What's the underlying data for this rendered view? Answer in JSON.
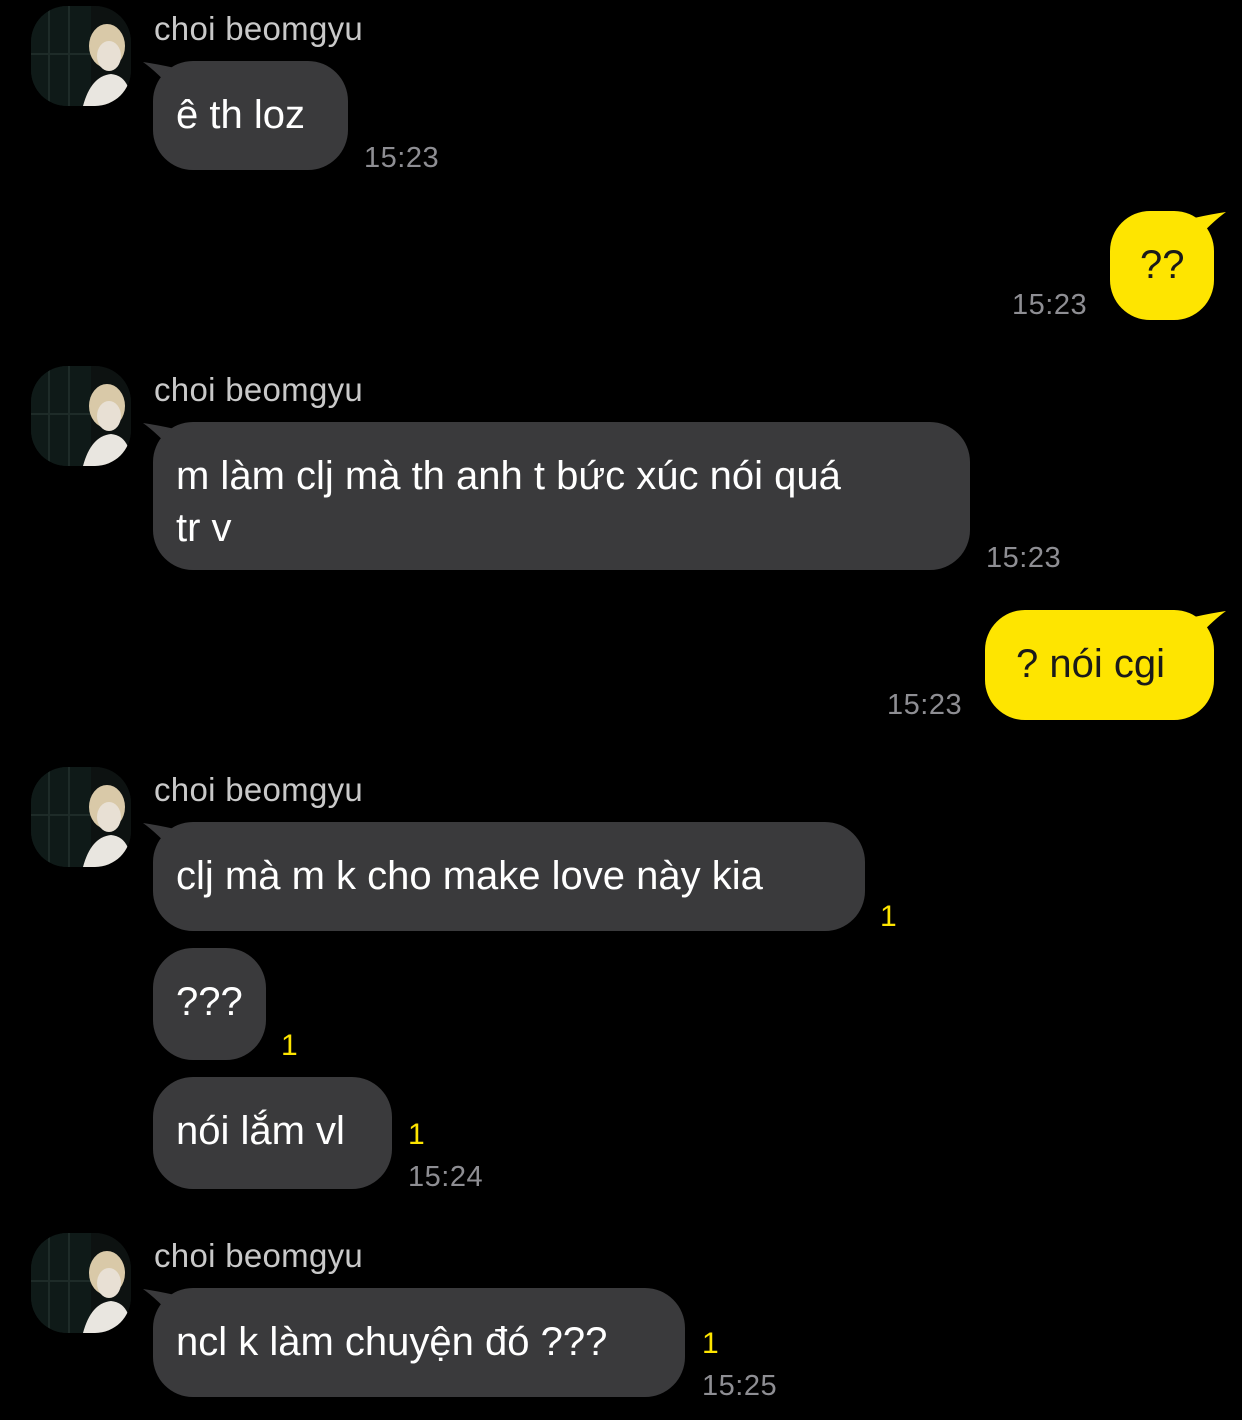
{
  "contact": {
    "name": "choi beomgyu"
  },
  "colors": {
    "background": "#000000",
    "incoming_bubble": "#3a3a3c",
    "outgoing_bubble": "#fee500",
    "timestamp": "#8e8e93",
    "unread_count": "#fee500",
    "sender_name": "#c9c9c9"
  },
  "messages": [
    {
      "direction": "incoming",
      "text": "ê th loz",
      "time": "15:23",
      "unread": ""
    },
    {
      "direction": "outgoing",
      "text": "??",
      "time": "15:23",
      "unread": ""
    },
    {
      "direction": "incoming",
      "text": "m làm clj mà th anh t bức xúc nói quá\ntr v",
      "time": "15:23",
      "unread": ""
    },
    {
      "direction": "outgoing",
      "text": "? nói cgi",
      "time": "15:23",
      "unread": ""
    },
    {
      "direction": "incoming",
      "text": "clj mà m k cho make love này kia",
      "time": "",
      "unread": "1"
    },
    {
      "direction": "incoming",
      "text": "???",
      "time": "",
      "unread": "1"
    },
    {
      "direction": "incoming",
      "text": "nói lắm vl",
      "time": "15:24",
      "unread": "1"
    },
    {
      "direction": "incoming",
      "text": "ncl k làm chuyện đó ???",
      "time": "15:25",
      "unread": "1"
    }
  ]
}
